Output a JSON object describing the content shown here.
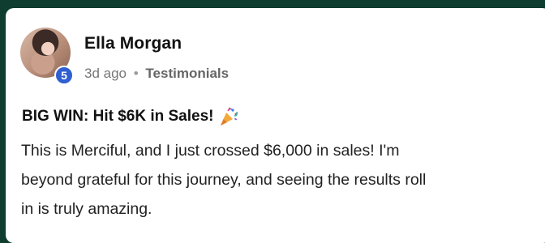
{
  "post": {
    "author": "Ella Morgan",
    "level": "5",
    "time": "3d ago",
    "separator": "•",
    "category": "Testimonials",
    "title": "BIG WIN: Hit $6K in Sales!",
    "title_icon": "party-popper-icon",
    "body_lines": [
      "This is Merciful, and I just crossed $6,000 in sales! I'm",
      "beyond grateful for this journey, and seeing the results roll",
      "in is truly amazing."
    ]
  },
  "colors": {
    "background": "#0f3d2f",
    "card": "#ffffff",
    "level_badge": "#2f5fd0"
  }
}
